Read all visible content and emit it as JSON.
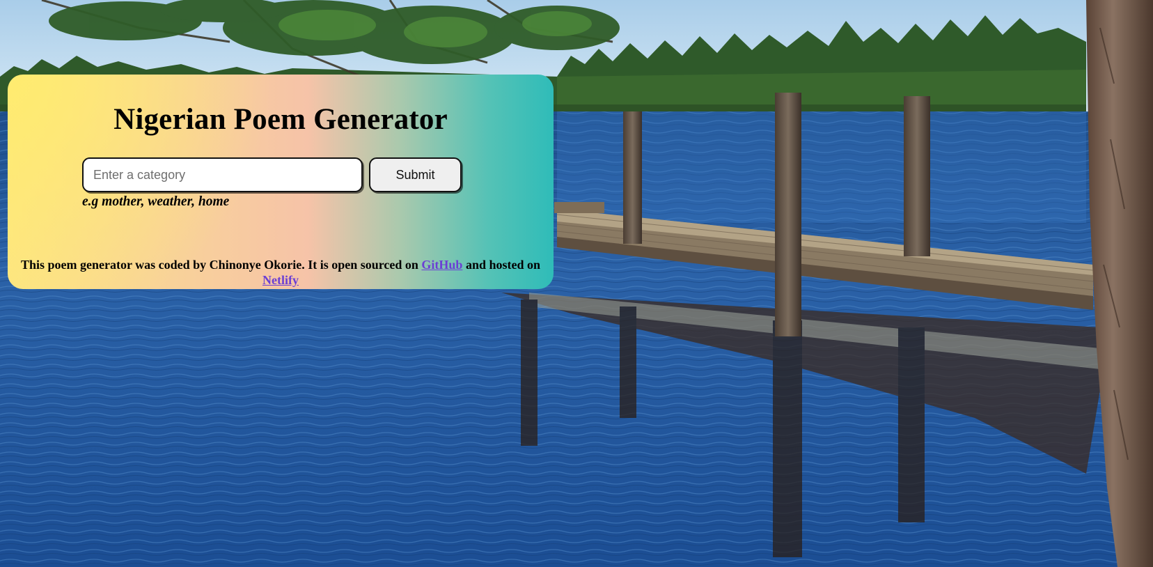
{
  "app": {
    "title": "Nigerian Poem Generator"
  },
  "search": {
    "placeholder": "Enter a category",
    "value": "",
    "submit_label": "Submit",
    "hint": "e.g mother, weather, home"
  },
  "footer": {
    "text_before": "This poem generator was coded by Chinonye Okorie. It is open sourced on ",
    "github_label": "GitHub",
    "text_middle": " and hosted on ",
    "netlify_label": "Netlify"
  },
  "colors": {
    "link": "#6b3fd4",
    "card_gradient_start": "#fde583",
    "card_gradient_mid": "#f6c3a8",
    "card_gradient_end": "#2fbcb8"
  },
  "background": {
    "description_icon": "lake-dock-photo"
  }
}
